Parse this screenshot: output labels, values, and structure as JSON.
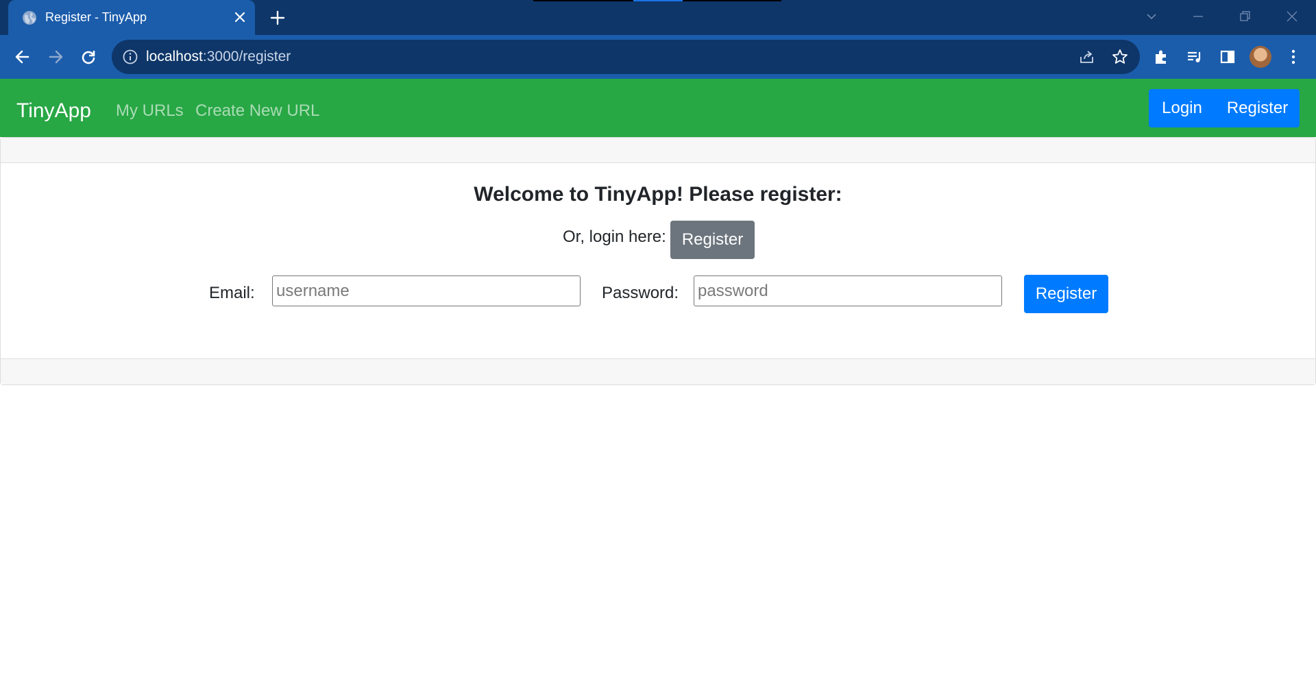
{
  "browser": {
    "tab_title": "Register - TinyApp",
    "url_host": "localhost",
    "url_path": ":3000/register",
    "icons": {
      "favicon": "globe-icon",
      "tab_close": "close-icon",
      "new_tab": "plus-icon",
      "tab_search": "chevron-down-icon",
      "minimize": "minimize-icon",
      "restore": "restore-icon",
      "close_window": "close-icon",
      "back": "arrow-left-icon",
      "forward": "arrow-right-icon",
      "reload": "reload-icon",
      "site_info": "info-icon",
      "share": "share-icon",
      "bookmark": "star-icon",
      "extensions": "puzzle-icon",
      "media": "media-queue-icon",
      "side_panel": "side-panel-icon",
      "profile": "avatar",
      "menu": "kebab-menu-icon"
    }
  },
  "navbar": {
    "brand": "TinyApp",
    "links": [
      "My URLs",
      "Create New URL"
    ],
    "login_label": "Login",
    "register_label": "Register",
    "color": "#28a745"
  },
  "main": {
    "heading": "Welcome to TinyApp! Please register:",
    "login_prompt": "Or, login here:",
    "login_button_label": "Register",
    "email_label": "Email:",
    "email_placeholder": "username",
    "email_value": "",
    "password_label": "Password:",
    "password_placeholder": "password",
    "password_value": "",
    "submit_label": "Register"
  },
  "colors": {
    "primary": "#007bff",
    "secondary": "#6c757d",
    "browser_frame": "#0e3669",
    "browser_toolbar": "#1b5dab"
  }
}
